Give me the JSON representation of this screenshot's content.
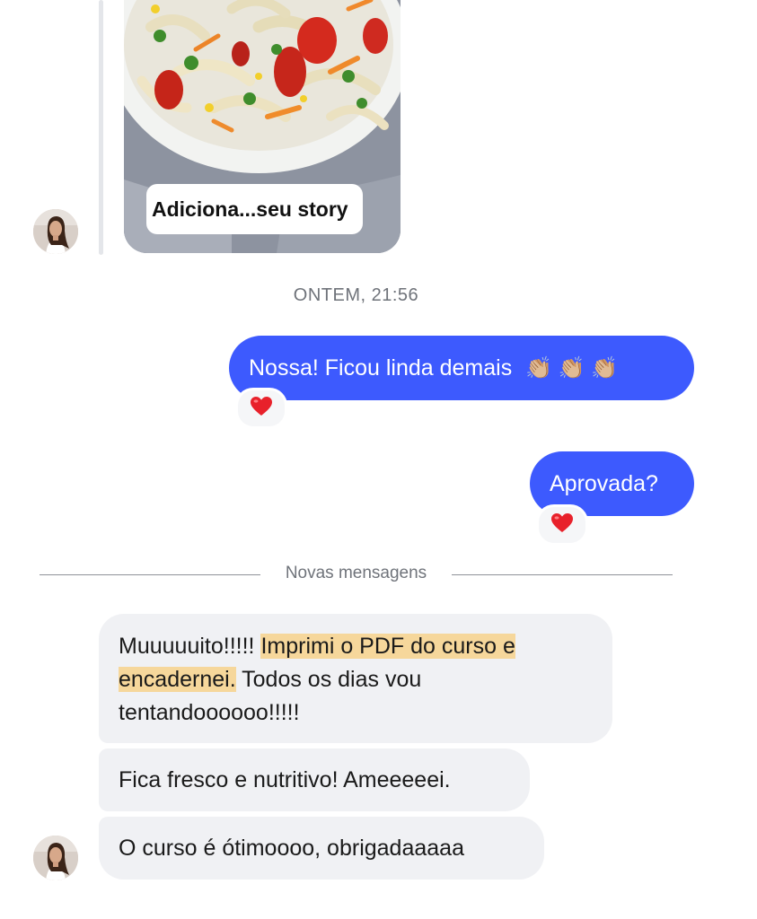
{
  "story": {
    "caption": "Adiciona...seu story"
  },
  "timestamp": "ONTEM, 21:56",
  "outgoing": [
    {
      "text": "Nossa! Ficou linda demais",
      "emoji": "👏🏼 👏🏼 👏🏼",
      "reaction": "heart-icon"
    },
    {
      "text": "Aprovada?",
      "reaction": "heart-icon"
    }
  ],
  "divider": {
    "label": "Novas mensagens"
  },
  "incoming": [
    {
      "part1": "Muuuuuito!!!!! ",
      "highlight": "Imprimi o PDF do curso e encadernei.",
      "part2": " Todos os dias vou tentandoooooo!!!!!"
    },
    {
      "text": "Fica fresco e nutritivo! Ameeeeei."
    },
    {
      "text": "O curso é ótimoooo, obrigadaaaaa"
    }
  ],
  "colors": {
    "outgoing_bubble": "#3d5afe",
    "incoming_bubble": "#f0f1f4",
    "highlight": "#f6d79b",
    "heart": "#e8212b"
  }
}
